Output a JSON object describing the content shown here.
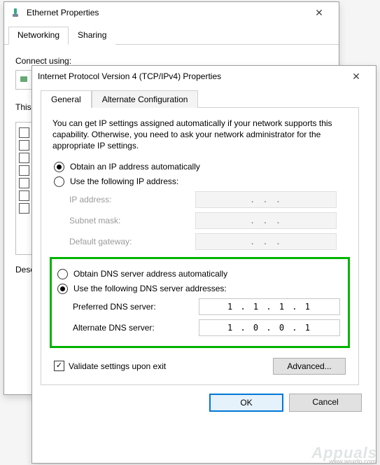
{
  "bg": {
    "title": "Ethernet Properties",
    "tabs": {
      "networking": "Networking",
      "sharing": "Sharing"
    },
    "connect_label": "Connect using:",
    "this_label": "This connection uses the following items:",
    "desc_label": "Description"
  },
  "fg": {
    "title": "Internet Protocol Version 4 (TCP/IPv4) Properties",
    "tabs": {
      "general": "General",
      "alt": "Alternate Configuration"
    },
    "desc": "You can get IP settings assigned automatically if your network supports this capability. Otherwise, you need to ask your network administrator for the appropriate IP settings.",
    "ip": {
      "auto": "Obtain an IP address automatically",
      "manual": "Use the following IP address:",
      "ip_label": "IP address:",
      "mask_label": "Subnet mask:",
      "gw_label": "Default gateway:",
      "placeholder": ".     .     ."
    },
    "dns": {
      "auto": "Obtain DNS server address automatically",
      "manual": "Use the following DNS server addresses:",
      "pref_label": "Preferred DNS server:",
      "alt_label": "Alternate DNS server:",
      "pref_value": "1 . 1 . 1 . 1",
      "alt_value": "1 . 0 . 0 . 1"
    },
    "validate": "Validate settings upon exit",
    "advanced": "Advanced...",
    "ok": "OK",
    "cancel": "Cancel"
  },
  "watermark": "Appuals",
  "watermark_url": "www.wsxdn.com"
}
